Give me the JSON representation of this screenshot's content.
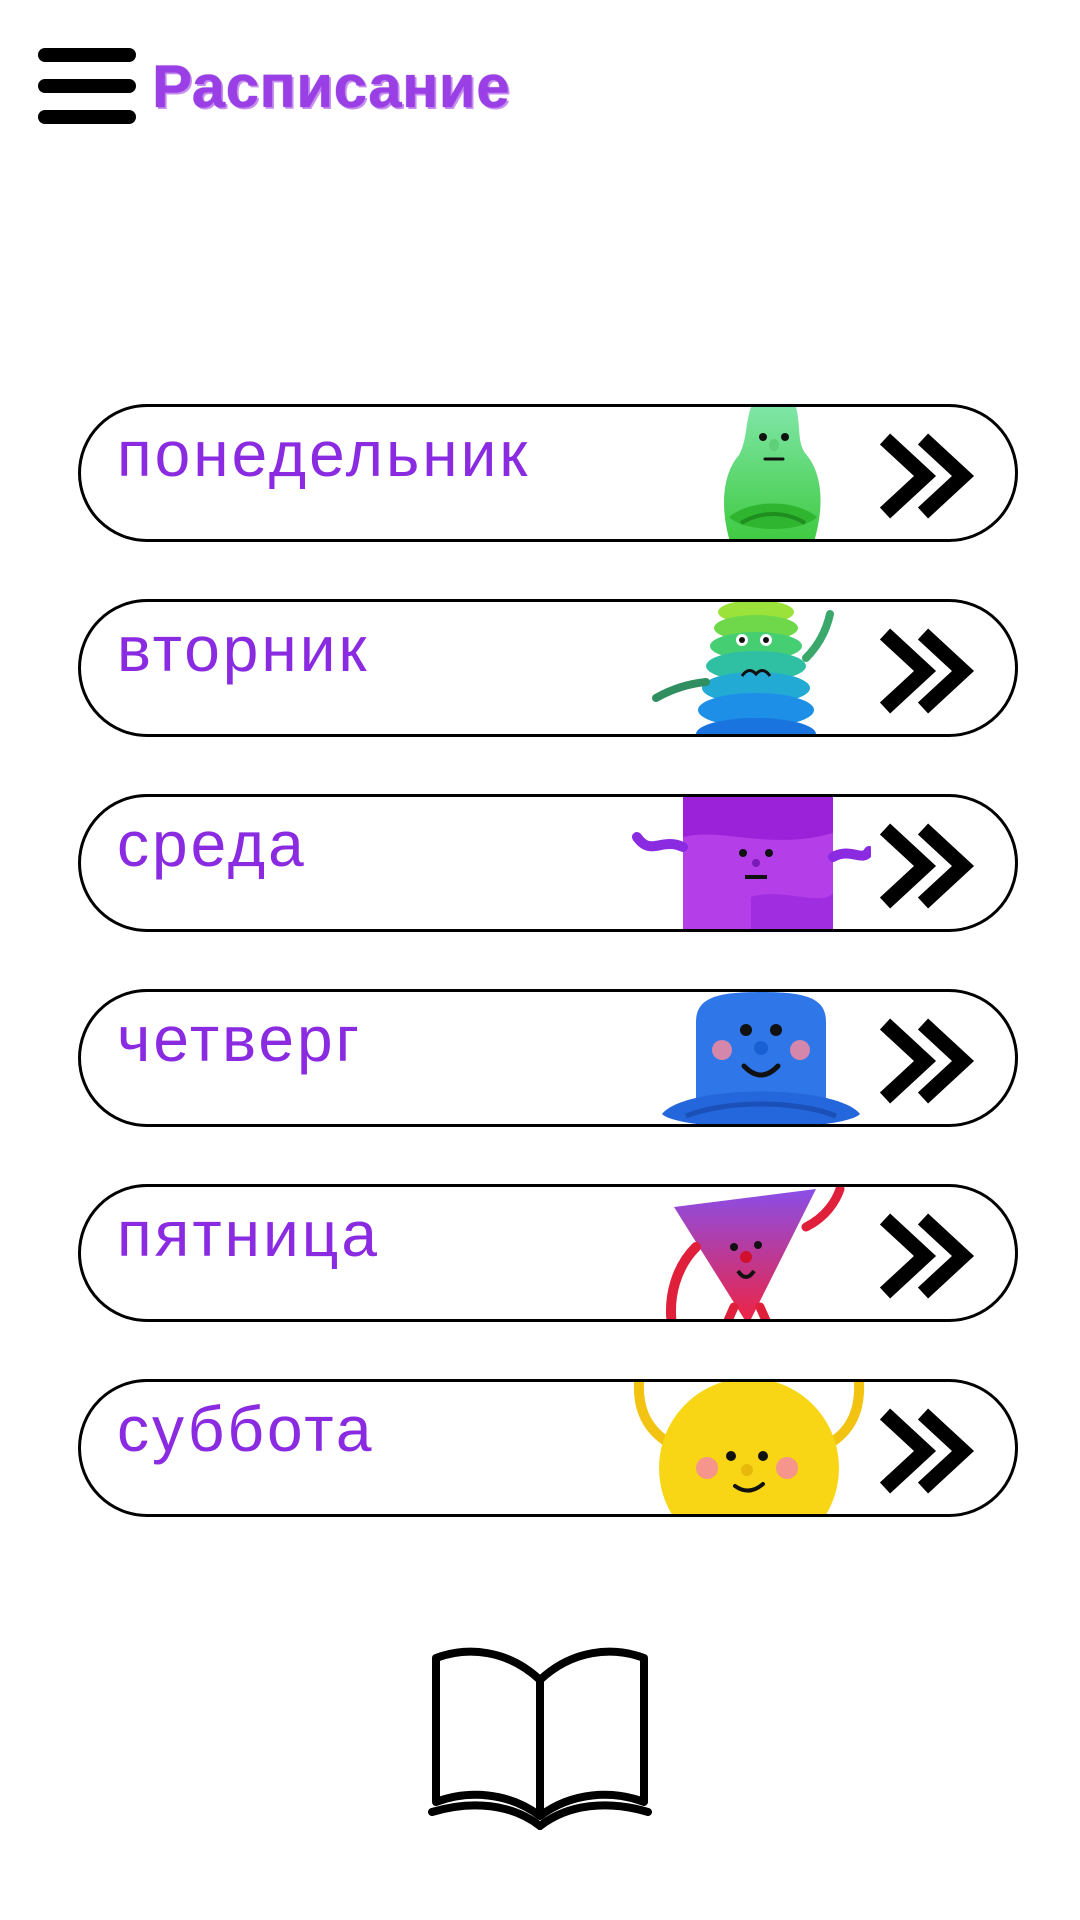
{
  "header": {
    "title": "Расписание",
    "menu_icon": "hamburger-menu-icon"
  },
  "colors": {
    "title": "#9a3fe6",
    "day_label": "#8a2be2",
    "outline": "#000000"
  },
  "days": [
    {
      "label": "понедельник",
      "mascot": "green-pear-mascot"
    },
    {
      "label": "вторник",
      "mascot": "ring-stack-mascot"
    },
    {
      "label": "среда",
      "mascot": "purple-block-mascot"
    },
    {
      "label": "четверг",
      "mascot": "blue-blob-mascot"
    },
    {
      "label": "пятница",
      "mascot": "red-cone-mascot"
    },
    {
      "label": "суббота",
      "mascot": "yellow-ball-mascot"
    }
  ],
  "footer": {
    "icon": "open-book-icon"
  }
}
